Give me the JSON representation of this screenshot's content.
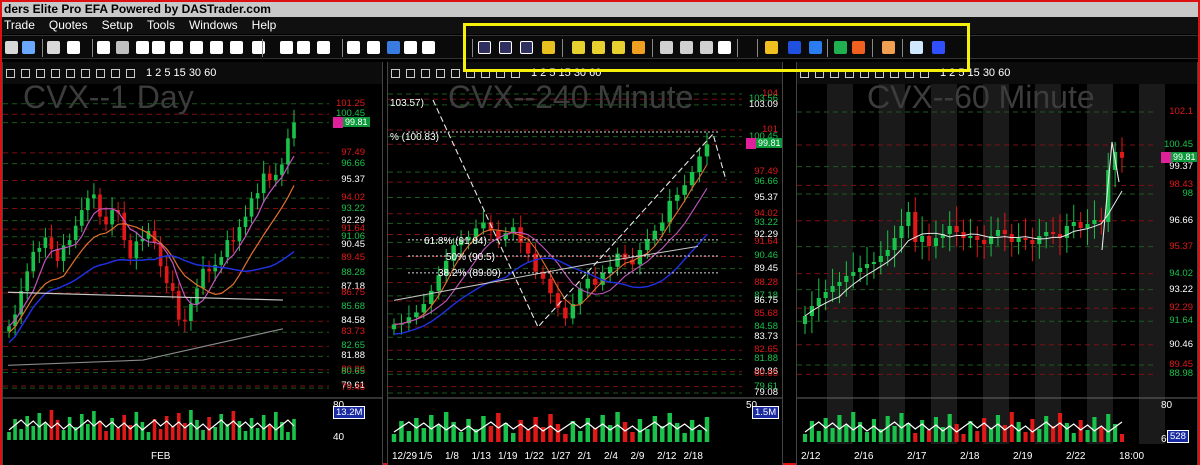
{
  "app": {
    "title": "ders Elite Pro EFA Powered by DASTrader.com"
  },
  "menu": [
    "Trade",
    "Quotes",
    "Setup",
    "Tools",
    "Windows",
    "Help"
  ],
  "colors": {
    "highlight": "#f5f10a",
    "up": "#19c24a",
    "down": "#e01818",
    "frame": "#d11111"
  },
  "icons": [
    "lock-icon",
    "globe-icon",
    "list-icon",
    "list-icon",
    "clock-icon",
    "link-icon",
    "info-icon",
    "list-icon",
    "chart-icon",
    "chart-icon",
    "chart-icon",
    "help-icon",
    "dollar-icon",
    "sitemap-icon",
    "select-icon",
    "grid-icon",
    "clock-icon",
    "alarm-icon",
    "video-icon",
    "mail-icon",
    "window-icon",
    "layout-icon",
    "layout-icon",
    "layout-icon",
    "chart-color-icon",
    "line-icon",
    "line-icon",
    "line-icon",
    "w-icon",
    "list-icon",
    "list-icon",
    "list-icon",
    "copy-icon",
    "folder-icon",
    "check-icon",
    "calendar-icon",
    "record-icon",
    "record-icon",
    "settings-icon",
    "doc-icon",
    "info-icon"
  ],
  "panes": [
    {
      "title": "CVX--1 Day",
      "tool_labels": "1  2  5  15  30  60",
      "price_labels": [
        "101.25",
        "100.45",
        "99.81",
        "97.49",
        "96.66",
        "95.37",
        "94.02",
        "93.22",
        "92.29",
        "91.64",
        "91.06",
        "90.45",
        "89.45",
        "88.28",
        "87.18",
        "86.75",
        "85.68",
        "84.58",
        "83.73",
        "82.65",
        "81.88",
        "80.86",
        "80.65",
        "79.61",
        "79.45"
      ],
      "last_price": "99.81",
      "volume_badge": "13.2M",
      "volume_labels": [
        "80",
        "40"
      ],
      "x_labels": [
        "FEB"
      ]
    },
    {
      "title": "CVX--240 Minute",
      "tool_labels": "1  2  5  15  30  60",
      "price_labels": [
        "104",
        "103.56",
        "103.09",
        "101",
        "100.45",
        "99.81",
        "97.49",
        "96.66",
        "95.37",
        "94.02",
        "93.22",
        "92.29",
        "91.64",
        "90.46",
        "89.45",
        "88.28",
        "87.18",
        "86.75",
        "85.68",
        "84.58",
        "83.73",
        "82.65",
        "81.88",
        "80.86",
        "80.65",
        "79.61",
        "79.08"
      ],
      "last_price": "99.81",
      "fib_labels": [
        "103.57)",
        "% (100.83)",
        "61.8% (91.84)",
        "50% (90.5)",
        "38.2% (89.09)"
      ],
      "volume_badge": "1.5M",
      "volume_labels": [
        "50"
      ],
      "x_labels": [
        "12/29",
        "1/5",
        "1/8",
        "1/13",
        "1/19",
        "1/22",
        "1/27",
        "2/1",
        "2/4",
        "2/9",
        "2/12",
        "2/18"
      ]
    },
    {
      "title": "CVX--60 Minute",
      "tool_labels": "1  2  5  15  30  60",
      "price_labels": [
        "102.1",
        "100.45",
        "99.37",
        "98.43",
        "98",
        "96.66",
        "95.37",
        "94.02",
        "93.22",
        "92.29",
        "91.64",
        "90.46",
        "89.45",
        "88.98"
      ],
      "last_price": "99.81",
      "volume_badge": "528",
      "volume_labels": [
        "80",
        "60"
      ],
      "x_labels": [
        "2/12",
        "2/16",
        "2/17",
        "2/18",
        "2/19",
        "2/22",
        "18:00"
      ]
    }
  ],
  "chart_data": [
    {
      "type": "candlestick",
      "title": "CVX--1 Day",
      "ylim": [
        79,
        102
      ],
      "close": [
        84.2,
        85.1,
        86.9,
        88.4,
        89.9,
        90.2,
        91.0,
        90.1,
        89.2,
        90.4,
        90.8,
        91.9,
        93.1,
        94.0,
        94.3,
        92.6,
        92.0,
        93.1,
        92.9,
        90.8,
        89.4,
        90.7,
        90.9,
        91.5,
        90.6,
        88.8,
        87.5,
        86.9,
        84.7,
        84.6,
        85.9,
        87.1,
        88.6,
        88.4,
        88.9,
        89.5,
        90.8,
        90.7,
        91.8,
        92.6,
        94.0,
        94.4,
        95.9,
        95.4,
        95.8,
        96.6,
        98.6,
        99.81
      ],
      "ma_fast_color": "#c056c0",
      "ma_mid_color": "#e07030",
      "ma_slow_color": "#2030e0"
    },
    {
      "type": "candlestick",
      "title": "CVX--240 Minute",
      "ylim": [
        79,
        104
      ],
      "close": [
        84.8,
        84.9,
        85.4,
        85.8,
        86.5,
        87.6,
        88.9,
        90.1,
        91.4,
        91.8,
        92.1,
        92.8,
        93.3,
        92.6,
        91.9,
        92.4,
        92.9,
        91.6,
        90.7,
        89.2,
        88.6,
        87.4,
        86.2,
        85.3,
        86.5,
        87.8,
        88.6,
        88.1,
        89.1,
        89.6,
        90.7,
        90.2,
        89.8,
        91.0,
        91.9,
        92.6,
        93.3,
        95.1,
        95.6,
        96.4,
        97.5,
        98.8,
        99.81
      ],
      "fibonacci": [
        100.83,
        91.84,
        90.5,
        89.09
      ]
    },
    {
      "type": "candlestick",
      "title": "CVX--60 Minute",
      "ylim": [
        88,
        103
      ],
      "close": [
        91.9,
        92.4,
        92.8,
        93.1,
        93.4,
        93.6,
        93.9,
        94.1,
        94.3,
        94.5,
        94.6,
        94.9,
        95.2,
        95.8,
        96.4,
        97.1,
        95.6,
        95.9,
        95.4,
        95.8,
        96.0,
        96.4,
        96.1,
        95.8,
        95.9,
        95.7,
        95.5,
        95.9,
        96.2,
        96.0,
        95.6,
        95.8,
        95.7,
        95.5,
        95.9,
        96.1,
        96.0,
        95.8,
        96.4,
        96.6,
        96.3,
        96.5,
        96.7,
        96.6,
        99.2,
        100.1,
        99.81
      ]
    }
  ]
}
